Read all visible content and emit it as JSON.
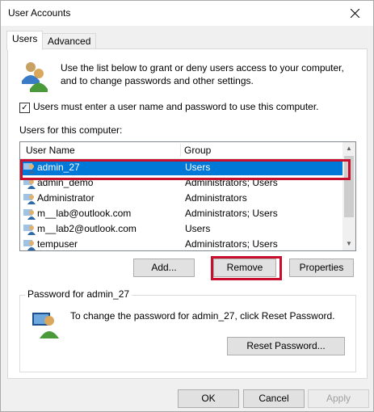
{
  "window": {
    "title": "User Accounts"
  },
  "tabs": [
    {
      "label": "Users"
    },
    {
      "label": "Advanced"
    }
  ],
  "intro_text": "Use the list below to grant or deny users access to your computer, and to change passwords and other settings.",
  "require_login": {
    "checked": true,
    "label": "Users must enter a user name and password to use this computer."
  },
  "users_label": "Users for this computer:",
  "list": {
    "columns": [
      "User Name",
      "Group"
    ],
    "rows": [
      {
        "name": "admin_27",
        "group": "Users",
        "selected": true
      },
      {
        "name": "admin_demo",
        "group": "Administrators; Users"
      },
      {
        "name": "Administrator",
        "group": "Administrators"
      },
      {
        "name": "m__lab@outlook.com",
        "group": "Administrators; Users"
      },
      {
        "name": "m__lab2@outlook.com",
        "group": "Users"
      },
      {
        "name": "tempuser",
        "group": "Administrators; Users"
      }
    ]
  },
  "buttons": {
    "add": "Add...",
    "remove": "Remove",
    "properties": "Properties",
    "reset_password": "Reset Password...",
    "ok": "OK",
    "cancel": "Cancel",
    "apply": "Apply"
  },
  "password_group": {
    "title": "Password for admin_27",
    "text": "To change the password for admin_27, click Reset Password."
  },
  "icons": {
    "close": "close-icon",
    "users": "users-icon",
    "user": "user-icon",
    "password": "password-icon"
  },
  "colors": {
    "selection": "#0078d7",
    "highlight": "#c8102e"
  }
}
